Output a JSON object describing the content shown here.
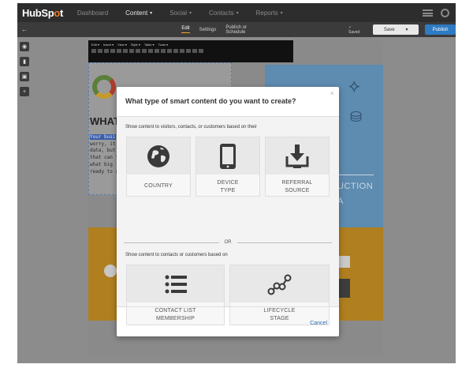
{
  "app": {
    "logo": {
      "text_a": "HubSp",
      "text_b": "t"
    },
    "nav": [
      {
        "label": "Dashboard",
        "caret": ""
      },
      {
        "label": "Content",
        "caret": "▾"
      },
      {
        "label": "Social",
        "caret": "▾"
      },
      {
        "label": "Contacts",
        "caret": "▾"
      },
      {
        "label": "Reports",
        "caret": "▾"
      }
    ],
    "menu_icon": "hamburger-icon",
    "user_icon": "user-icon"
  },
  "editor_bar": {
    "back_glyph": "←",
    "tabs": [
      "Edit",
      "Settings",
      "Publish or Schedule"
    ],
    "saved_text": "✓ Saved",
    "save_label": "Save",
    "save_caret": "▾",
    "publish_label": "Publish"
  },
  "rail": [
    {
      "icon": "eye-icon",
      "glyph": "◉"
    },
    {
      "icon": "chart-icon",
      "glyph": "▮"
    },
    {
      "icon": "module-icon",
      "glyph": "▣"
    },
    {
      "icon": "add-icon",
      "glyph": "+"
    }
  ],
  "rich_text_toolbar": {
    "menus": [
      "Edit ▾",
      "Insert ▾",
      "View ▾",
      "Style ▾",
      "Table ▾",
      "Tools ▾"
    ]
  },
  "canvas": {
    "heading": "WHAT",
    "body_lines": [
      "Your busi",
      "worry, it's",
      "data, but",
      "that can fi",
      "what big ",
      "ready to u"
    ],
    "panel_text_1": "UCTION",
    "panel_text_2": "A"
  },
  "modal": {
    "title": "What type of smart content do you want to create?",
    "close_glyph": "×",
    "section1_label": "Show content to visitors, contacts, or customers based on their",
    "cards_row1": [
      {
        "icon": "globe-icon",
        "line1": "COUNTRY",
        "line2": ""
      },
      {
        "icon": "mobile-device-icon",
        "line1": "DEVICE",
        "line2": "TYPE"
      },
      {
        "icon": "download-tray-icon",
        "line1": "REFERRAL",
        "line2": "SOURCE"
      }
    ],
    "or_text": "OR",
    "section2_label": "Show content to contacts or customers based on",
    "cards_row2": [
      {
        "icon": "list-icon",
        "line1": "CONTACT LIST",
        "line2": "MEMBERSHIP"
      },
      {
        "icon": "lifecycle-stages-icon",
        "line1": "LIFECYCLE",
        "line2": "STAGE"
      }
    ],
    "cancel_label": "Cancel"
  },
  "colors": {
    "nav_bg": "#2d2d2d",
    "accent_orange": "#f57722",
    "publish_blue": "#2e7bc4",
    "link_blue": "#2a6db5",
    "overlay_gray": "#8c8c8c"
  }
}
